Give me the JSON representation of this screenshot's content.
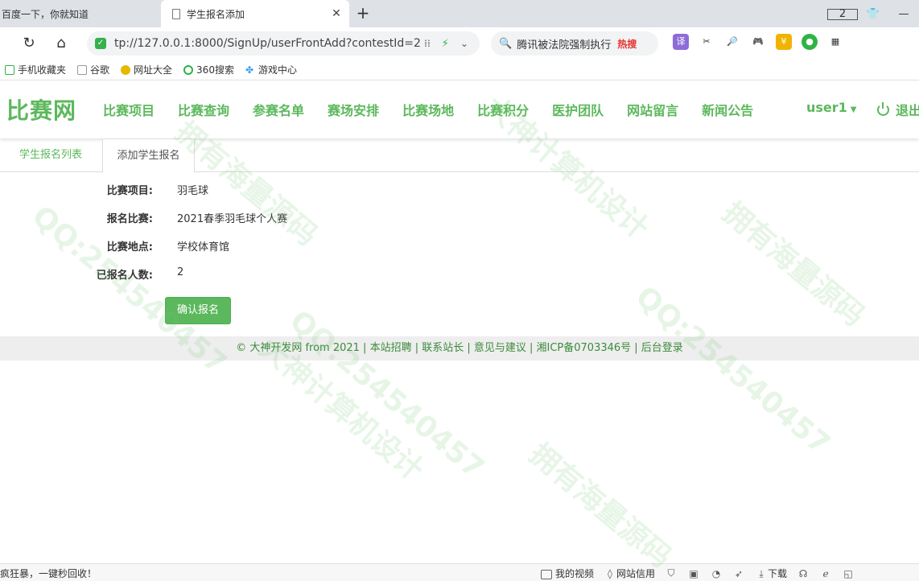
{
  "browser": {
    "tabs": [
      {
        "title": "百度一下，你就知道"
      },
      {
        "title": "学生报名添加"
      }
    ],
    "tab_count": "2",
    "url": "tp://127.0.0.1:8000/SignUp/userFrontAdd?contestId=2",
    "search_text": "腾讯被法院强制执行",
    "search_badge": "热搜",
    "translate_label": "译"
  },
  "bookmarks": [
    {
      "label": "手机收藏夹"
    },
    {
      "label": "谷歌"
    },
    {
      "label": "网址大全"
    },
    {
      "label": "360搜索"
    },
    {
      "label": "游戏中心"
    }
  ],
  "site": {
    "brand": "比赛网",
    "menu": [
      {
        "label": "比赛项目"
      },
      {
        "label": "比赛查询"
      },
      {
        "label": "参赛名单"
      },
      {
        "label": "赛场安排"
      },
      {
        "label": "比赛场地"
      },
      {
        "label": "比赛积分"
      },
      {
        "label": "医护团队"
      },
      {
        "label": "网站留言"
      },
      {
        "label": "新闻公告"
      }
    ],
    "user": "user1",
    "logout": "退出"
  },
  "page_tabs": [
    {
      "label": "学生报名列表"
    },
    {
      "label": "添加学生报名"
    }
  ],
  "form": {
    "rows": [
      {
        "label": "比赛项目:",
        "value": "羽毛球"
      },
      {
        "label": "报名比赛:",
        "value": "2021春季羽毛球个人赛"
      },
      {
        "label": "比赛地点:",
        "value": "学校体育馆"
      },
      {
        "label": "已报名人数:",
        "value": "2"
      }
    ],
    "confirm_label": "确认报名"
  },
  "footer": {
    "text": "© 大神开发网 from 2021 | 本站招聘 | 联系站长 | 意见与建议 | 湘ICP备0703346号 | 后台登录"
  },
  "statusbar": {
    "left_text": "疯狂暴，一键秒回收！",
    "my_video": "我的视频",
    "site_credit": "网站信用",
    "download": "下载"
  },
  "watermarks": [
    "QQ:254540457",
    "大神计算机设计",
    "拥有海量源码"
  ],
  "colors": {
    "accent": "#5cb85c",
    "footer_text": "#3c8a3c",
    "hot": "#e5322d"
  }
}
